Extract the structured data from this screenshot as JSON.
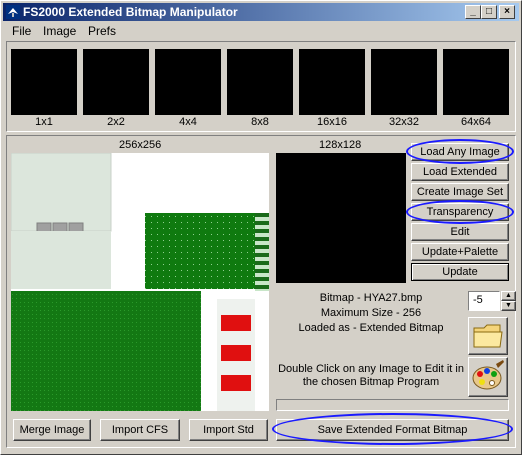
{
  "window": {
    "title": "FS2000 Extended Bitmap Manipulator",
    "minimize_glyph": "_",
    "maximize_glyph": "□",
    "close_glyph": "×"
  },
  "menu": [
    "File",
    "Image",
    "Prefs"
  ],
  "thumbnails": [
    "1x1",
    "2x2",
    "4x4",
    "8x8",
    "16x16",
    "32x32",
    "64x64"
  ],
  "preview": {
    "large_label": "256x256",
    "small_label": "128x128"
  },
  "side_buttons": {
    "load_any": "Load Any Image",
    "load_extended": "Load Extended",
    "create_set": "Create Image Set",
    "transparency": "Transparency",
    "edit": "Edit",
    "update_palette": "Update+Palette",
    "update": "Update"
  },
  "info": {
    "bitmap": "Bitmap - HYA27.bmp",
    "max_size": "Maximum Size - 256",
    "loaded_as": "Loaded as - Extended Bitmap",
    "hint_line1": "Double Click on any Image to Edit it in",
    "hint_line2": "the chosen Bitmap Program"
  },
  "spinner": {
    "value": "-5"
  },
  "bottom_buttons": {
    "merge": "Merge Image",
    "import_cfs": "Import CFS",
    "import_std": "Import Std",
    "save_extended": "Save Extended Format Bitmap"
  },
  "icons": [
    "app-icon",
    "folder-icon",
    "palette-icon",
    "spin-up-icon",
    "spin-down-icon"
  ],
  "colors": {
    "highlight_oval": "#1a1aff",
    "title_start": "#0a246a",
    "title_end": "#a6caf0",
    "face": "#d4d0c8"
  }
}
